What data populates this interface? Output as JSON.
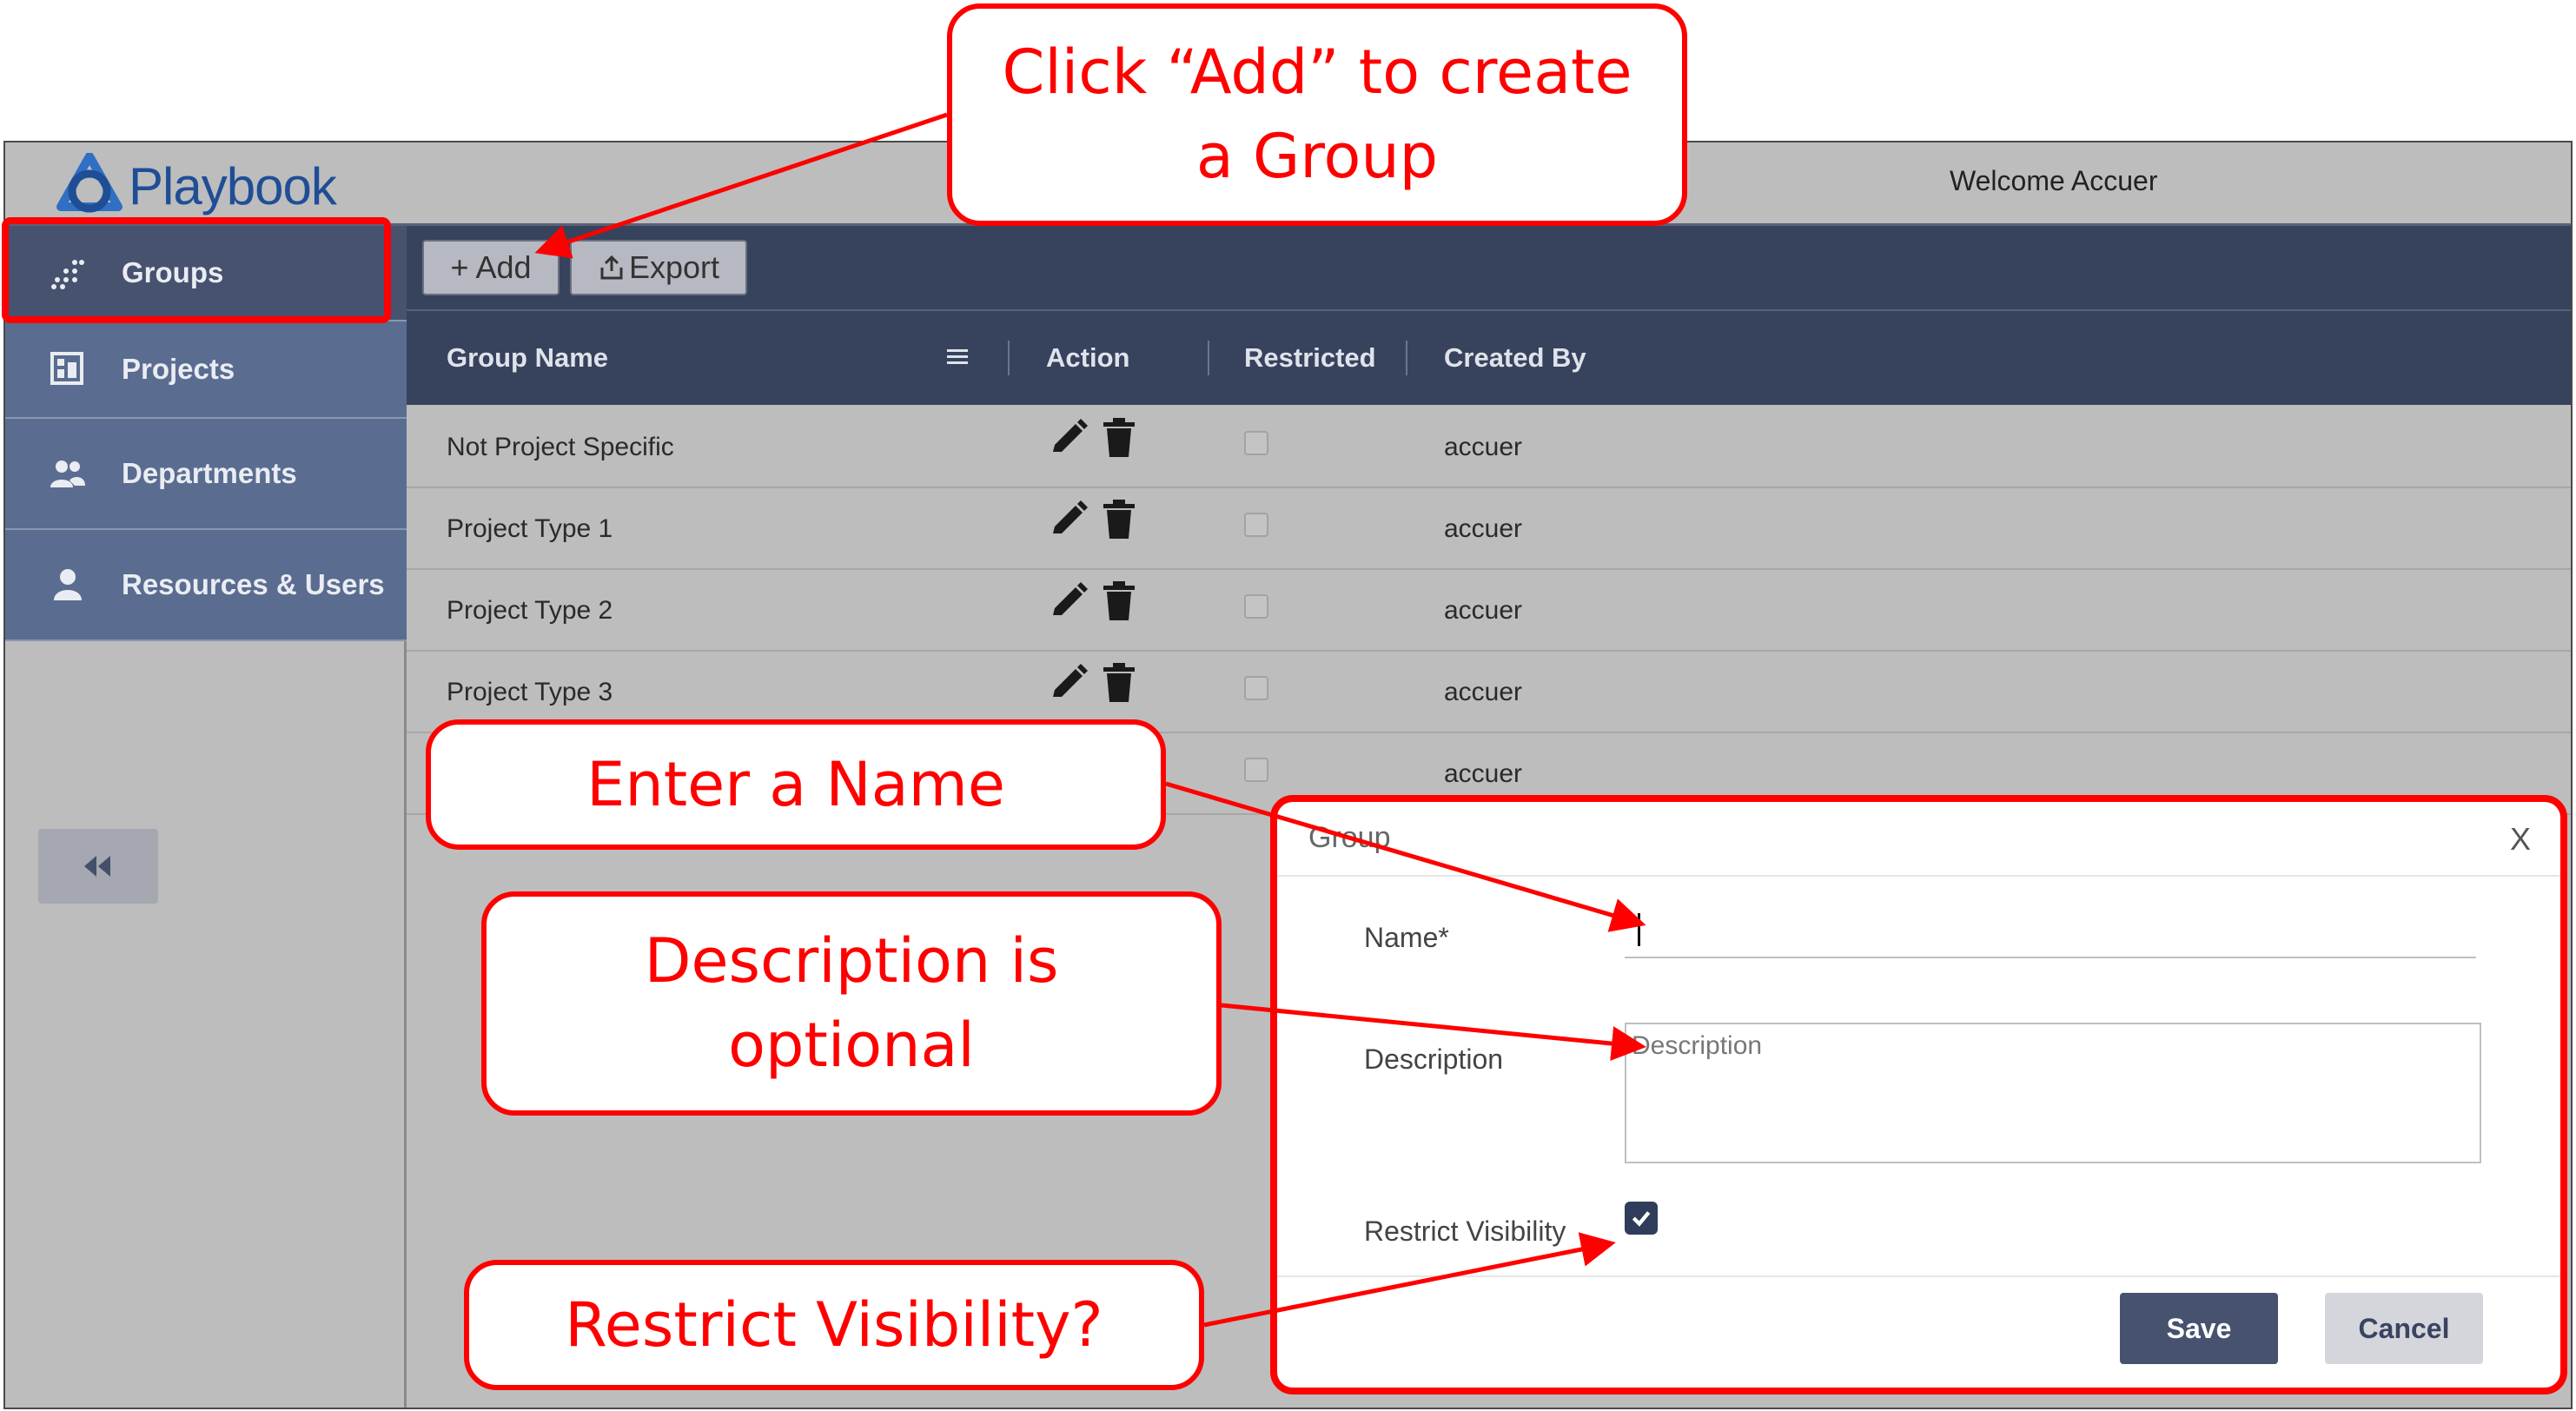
{
  "app": {
    "brand": "Playbook",
    "welcome": "Welcome Accuer"
  },
  "sidebar": {
    "items": [
      {
        "label": "Groups",
        "icon": "groups-icon",
        "active": true
      },
      {
        "label": "Projects",
        "icon": "projects-icon",
        "active": false
      },
      {
        "label": "Departments",
        "icon": "departments-icon",
        "active": false
      },
      {
        "label": "Resources & Users",
        "icon": "user-icon",
        "active": false
      }
    ],
    "collapse_icon": "double-chevron-left-icon"
  },
  "toolbar": {
    "add_label": "+ Add",
    "export_label": "Export"
  },
  "table": {
    "columns": [
      "Group Name",
      "Action",
      "Restricted",
      "Created By"
    ],
    "rows": [
      {
        "name": "Not Project Specific",
        "created_by": "accuer"
      },
      {
        "name": "Project Type 1",
        "created_by": "accuer"
      },
      {
        "name": "Project Type 2",
        "created_by": "accuer"
      },
      {
        "name": "Project Type 3",
        "created_by": "accuer"
      },
      {
        "name": "",
        "created_by": "accuer"
      }
    ]
  },
  "modal": {
    "title": "Group",
    "close": "X",
    "name_label": "Name*",
    "description_label": "Description",
    "description_placeholder": "Description",
    "restrict_label": "Restrict Visibility",
    "restrict_checked": true,
    "save_label": "Save",
    "cancel_label": "Cancel"
  },
  "callouts": {
    "add_line1": "Click “Add” to create",
    "add_line2": "a Group",
    "name": "Enter a Name",
    "desc_line1": "Description is",
    "desc_line2": "optional",
    "restrict": "Restrict Visibility?"
  },
  "colors": {
    "annotation_red": "#ff0000",
    "nav_blue": "#5a6c8f",
    "header_dark": "#37425d",
    "brand_blue": "#1f4e96"
  }
}
